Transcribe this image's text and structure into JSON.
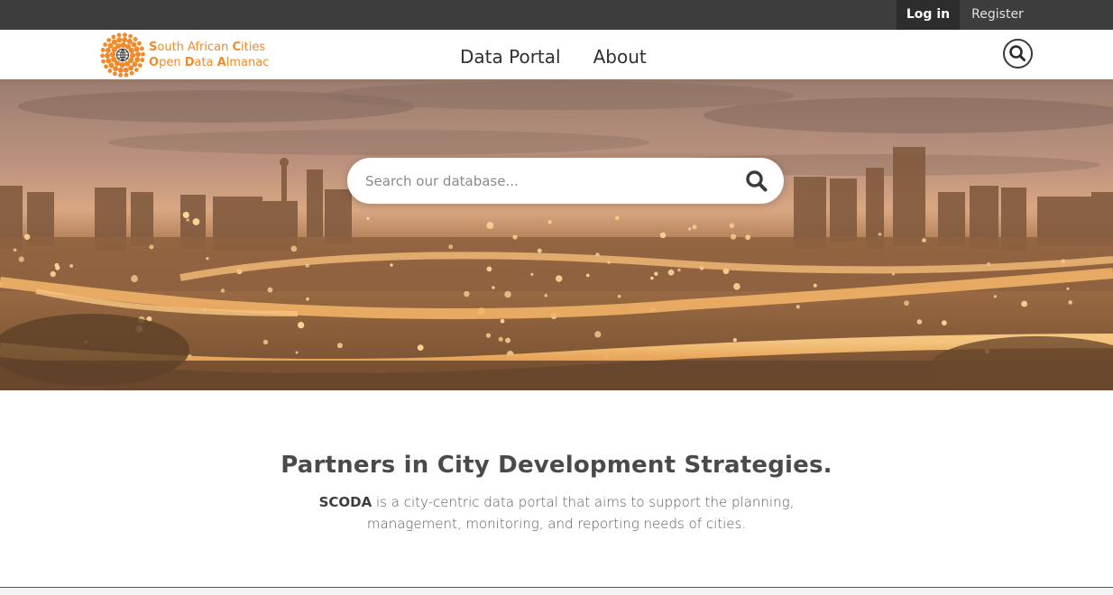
{
  "topbar": {
    "login_label": "Log in",
    "register_label": "Register"
  },
  "logo": {
    "line1": [
      {
        "text": "S",
        "cap": true
      },
      {
        "text": "outh African ",
        "cap": false
      },
      {
        "text": "C",
        "cap": true
      },
      {
        "text": "ities",
        "cap": false
      }
    ],
    "line2": [
      {
        "text": "O",
        "cap": true
      },
      {
        "text": "pen ",
        "cap": false
      },
      {
        "text": "D",
        "cap": true
      },
      {
        "text": "ata ",
        "cap": false
      },
      {
        "text": "A",
        "cap": true
      },
      {
        "text": "lmanac",
        "cap": false
      }
    ],
    "color": "#f08a2b"
  },
  "nav": {
    "items": [
      {
        "label": "Data Portal"
      },
      {
        "label": "About"
      }
    ]
  },
  "hero": {
    "search_placeholder": "Search our database..."
  },
  "intro": {
    "heading": "Partners in City Development Strategies.",
    "brand": "SCODA",
    "body": " is a city-centric data portal that aims to support the planning, management, monitoring, and reporting needs of cities."
  },
  "colors": {
    "accent": "#f08a2b",
    "topbar": "#3d3d3d",
    "text": "#4a4a4a"
  }
}
